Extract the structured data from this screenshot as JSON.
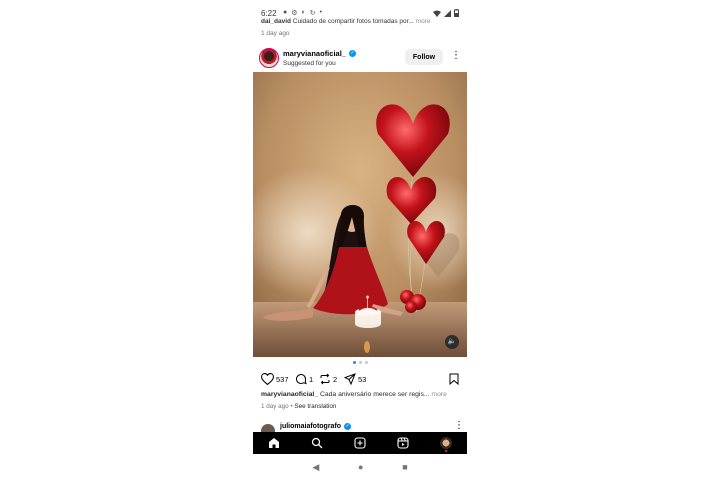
{
  "status_bar": {
    "time": "6:22",
    "notification_icons": [
      "chat-icon",
      "settings-icon",
      "headset-icon",
      "refresh-icon",
      "dot-icon"
    ],
    "system_icons": [
      "wifi-icon",
      "signal-icon",
      "battery-icon"
    ]
  },
  "previous_post": {
    "caption_user": "dai_david",
    "caption_text": "Cuidado de compartir fotos tomadas por...",
    "more_label": "more",
    "time": "1 day ago"
  },
  "post": {
    "username": "maryvianaoficial_",
    "verified": true,
    "subtitle": "Suggested for you",
    "follow_label": "Follow",
    "carousel_count": 3,
    "carousel_active": 0,
    "likes": "537",
    "comments": "1",
    "reposts": "2",
    "shares": "53",
    "caption_user": "maryvianaoficial_",
    "caption_text": "Cada aniversário merece ser regis...",
    "more_label": "more",
    "time": "1 day ago",
    "separator": "•",
    "see_translation": "See translation"
  },
  "next_post": {
    "username": "juliomaiafotografo",
    "verified": true
  },
  "bottom_nav": [
    "home-icon",
    "search-icon",
    "create-icon",
    "reels-icon",
    "profile-avatar"
  ],
  "colors": {
    "verified_blue": "#0095f6",
    "follow_bg": "#efefef",
    "nav_bg": "#000000",
    "muted_text": "#737373"
  }
}
